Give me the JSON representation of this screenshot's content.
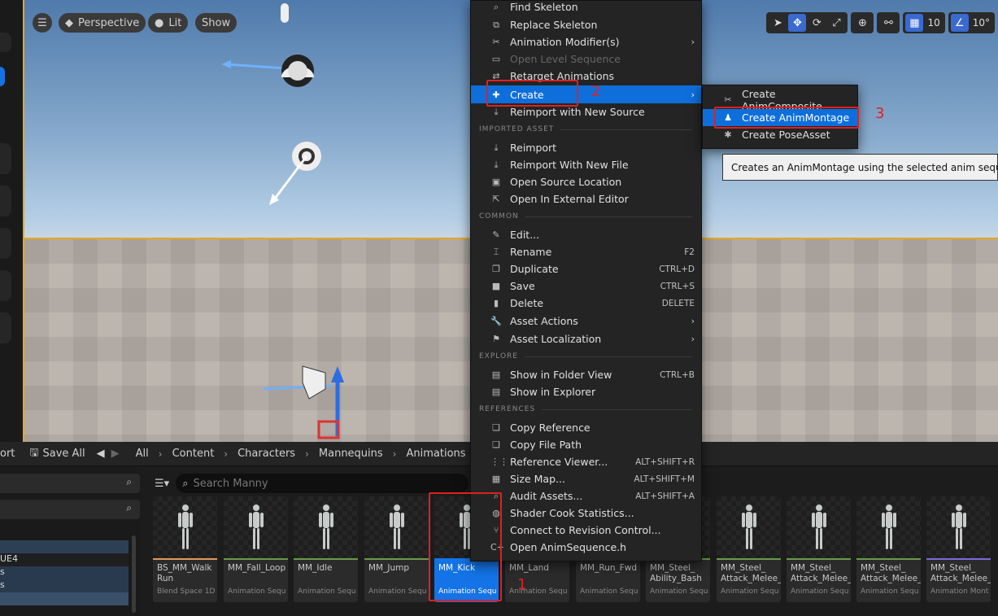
{
  "viewport": {
    "perspective_label": "Perspective",
    "lit_label": "Lit",
    "show_label": "Show",
    "grid_snap": "10",
    "rotation_snap": "10°"
  },
  "toolbar": {
    "port_label": "ort",
    "save_all_label": "Save All",
    "breadcrumbs": [
      "All",
      "Content",
      "Characters",
      "Mannequins",
      "Animations"
    ]
  },
  "left_panel": {
    "tree_items": [
      "UE4",
      "s",
      "s"
    ]
  },
  "search": {
    "placeholder": "Search Manny"
  },
  "assets": [
    {
      "name": "BS_MM_Walk Run",
      "type": "Blend Space 1D"
    },
    {
      "name": "MM_Fall_Loop",
      "type": "Animation Sequence"
    },
    {
      "name": "MM_Idle",
      "type": "Animation Sequence"
    },
    {
      "name": "MM_Jump",
      "type": "Animation Sequence"
    },
    {
      "name": "MM_Kick",
      "type": "Animation Sequence"
    },
    {
      "name": "MM_Land",
      "type": "Animation Sequence"
    },
    {
      "name": "MM_Run_Fwd",
      "type": "Animation Sequence"
    },
    {
      "name": "MM_Steel_ Ability_Bash",
      "type": "Animation Sequence"
    },
    {
      "name": "MM_Steel_ Attack_Melee_",
      "type": "Animation Sequence"
    },
    {
      "name": "MM_Steel_ Attack_Melee_",
      "type": "Animation Sequence"
    },
    {
      "name": "MM_Steel_ Attack_Melee_",
      "type": "Animation Sequence"
    },
    {
      "name": "MM_Steel_ Attack_Melee_",
      "type": "Animation Montage"
    }
  ],
  "context_menu": {
    "items": [
      {
        "label": "Find Skeleton",
        "icon": "search-icon"
      },
      {
        "label": "Replace Skeleton",
        "icon": "skeleton-icon"
      },
      {
        "label": "Animation Modifier(s)",
        "icon": "modifier-icon",
        "submenu": true
      },
      {
        "label": "Open Level Sequence",
        "icon": "sequence-icon",
        "disabled": true
      },
      {
        "label": "Retarget Animations",
        "icon": "retarget-icon"
      },
      {
        "label": "Create",
        "icon": "create-icon",
        "submenu": true,
        "highlighted": true
      },
      {
        "label": "Reimport with New Source",
        "icon": "reimport-icon"
      }
    ],
    "section_imported": "IMPORTED ASSET",
    "imported_items": [
      {
        "label": "Reimport",
        "icon": "reimport-icon"
      },
      {
        "label": "Reimport With New File",
        "icon": "reimport-icon"
      },
      {
        "label": "Open Source Location",
        "icon": "folder-icon"
      },
      {
        "label": "Open In External Editor",
        "icon": "external-icon"
      }
    ],
    "section_common": "COMMON",
    "common_items": [
      {
        "label": "Edit...",
        "icon": "pencil-icon",
        "shortcut": ""
      },
      {
        "label": "Rename",
        "icon": "rename-icon",
        "shortcut": "F2"
      },
      {
        "label": "Duplicate",
        "icon": "duplicate-icon",
        "shortcut": "CTRL+D"
      },
      {
        "label": "Save",
        "icon": "save-icon",
        "shortcut": "CTRL+S"
      },
      {
        "label": "Delete",
        "icon": "trash-icon",
        "shortcut": "DELETE"
      },
      {
        "label": "Asset Actions",
        "icon": "wrench-icon",
        "shortcut": "",
        "submenu": true
      },
      {
        "label": "Asset Localization",
        "icon": "flag-icon",
        "shortcut": "",
        "submenu": true
      }
    ],
    "section_explore": "EXPLORE",
    "explore_items": [
      {
        "label": "Show in Folder View",
        "icon": "folder-search-icon",
        "shortcut": "CTRL+B"
      },
      {
        "label": "Show in Explorer",
        "icon": "folder-search-icon",
        "shortcut": ""
      }
    ],
    "section_references": "REFERENCES",
    "references_items": [
      {
        "label": "Copy Reference",
        "icon": "copy-icon",
        "shortcut": ""
      },
      {
        "label": "Copy File Path",
        "icon": "copy-icon",
        "shortcut": ""
      },
      {
        "label": "Reference Viewer...",
        "icon": "graph-icon",
        "shortcut": "ALT+SHIFT+R"
      },
      {
        "label": "Size Map...",
        "icon": "sizemap-icon",
        "shortcut": "ALT+SHIFT+M"
      },
      {
        "label": "Audit Assets...",
        "icon": "audit-icon",
        "shortcut": "ALT+SHIFT+A"
      },
      {
        "label": "Shader Cook Statistics...",
        "icon": "shader-icon",
        "shortcut": ""
      },
      {
        "label": "Connect to Revision Control...",
        "icon": "revision-icon",
        "shortcut": ""
      },
      {
        "label": "Open AnimSequence.h",
        "icon": "code-icon",
        "shortcut": ""
      }
    ]
  },
  "create_submenu": {
    "items": [
      {
        "label": "Create AnimComposite",
        "icon": "anim-composite-icon"
      },
      {
        "label": "Create AnimMontage",
        "icon": "anim-montage-icon",
        "highlighted": true
      },
      {
        "label": "Create PoseAsset",
        "icon": "pose-asset-icon"
      }
    ]
  },
  "tooltip": "Creates an AnimMontage using the selected anim sequence.",
  "annotations": [
    "1",
    "2",
    "3"
  ],
  "colors": {
    "accent": "#0e6fdb",
    "annotation": "#e02020",
    "selection_outline": "#e8a820"
  }
}
